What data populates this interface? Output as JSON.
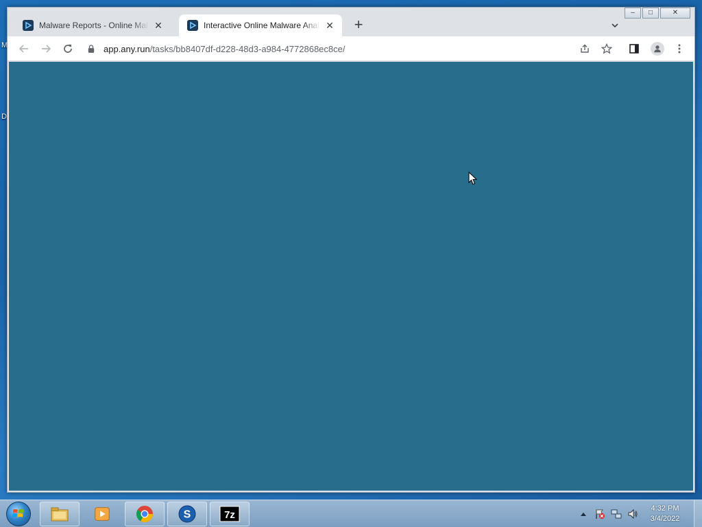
{
  "desktop": {
    "label_top": "M",
    "label_mid": "D"
  },
  "browser": {
    "tabs": [
      {
        "title": "Malware Reports - Online Malware Analysis",
        "close": "✕",
        "active": false
      },
      {
        "title": "Interactive Online Malware Analysis Sandbox",
        "close": "✕",
        "active": true
      }
    ],
    "new_tab": "+",
    "tab_search_icon": "chevron-down-icon",
    "url_host": "app.any.run",
    "url_path": "/tasks/bb8407df-d228-48d3-a984-4772868ec8ce/",
    "viewport_color": "#296d8d"
  },
  "window_controls": {
    "minimize": "–",
    "maximize": "□",
    "close": "✕"
  },
  "taskbar": {
    "apps": [
      "file-explorer-icon",
      "media-player-icon",
      "chrome-icon",
      "skype-icon",
      "7zip-icon"
    ],
    "clock_time": "4:32 PM",
    "clock_date": "3/4/2022"
  }
}
